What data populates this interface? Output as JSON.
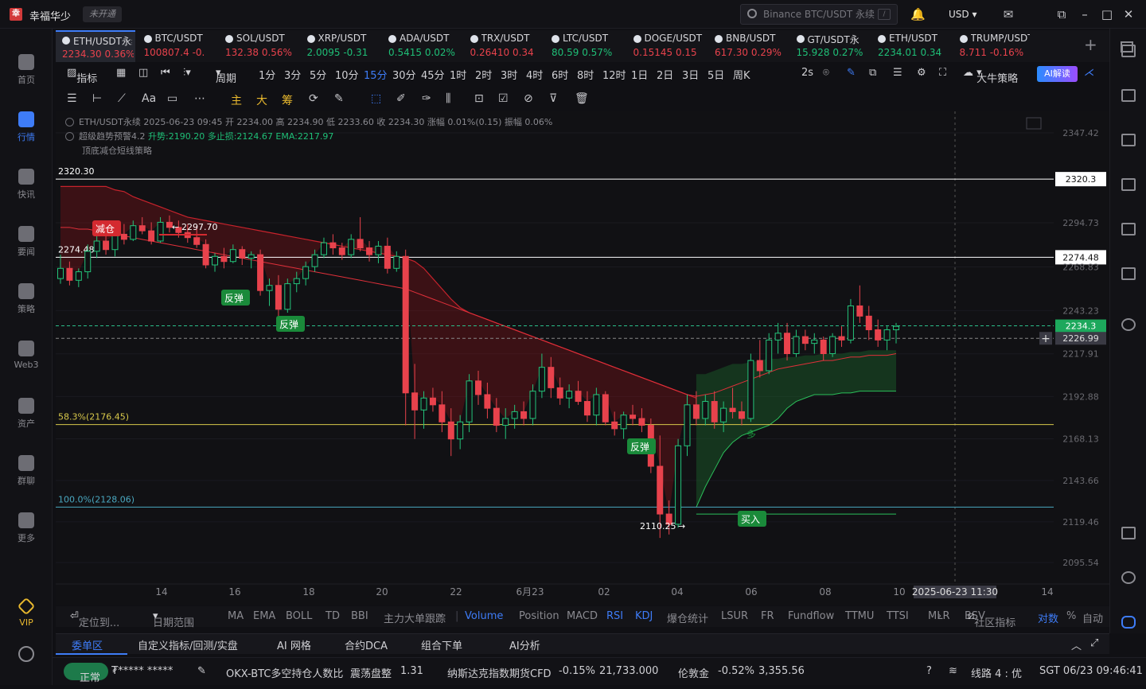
{
  "titlebar": {
    "app_name": "幸福华少",
    "unverified": "未开通",
    "search_placeholder": "Binance BTC/USDT 永续",
    "search_shortcut": "/",
    "currency": "USD"
  },
  "sidebar": {
    "items": [
      {
        "label": "首页",
        "icon": "home-icon"
      },
      {
        "label": "行情",
        "icon": "chart-icon",
        "active": true
      },
      {
        "label": "快讯",
        "icon": "news-icon"
      },
      {
        "label": "要闻",
        "icon": "headline-icon"
      },
      {
        "label": "策略",
        "icon": "strategy-icon"
      },
      {
        "label": "Web3",
        "icon": "web3-icon"
      },
      {
        "label": "资产",
        "icon": "wallet-icon"
      },
      {
        "label": "群聊",
        "icon": "chat-icon"
      },
      {
        "label": "更多",
        "icon": "more-icon"
      }
    ],
    "vip_label": "VIP"
  },
  "tickers": [
    {
      "name": "ETH/USDT永续",
      "price": "2234.30",
      "change": "0.36%",
      "dir": "dn",
      "active": true
    },
    {
      "name": "BTC/USDT",
      "price": "100807.4",
      "change": "-0.",
      "dir": "dn"
    },
    {
      "name": "SOL/USDT",
      "price": "132.38",
      "change": "0.56%",
      "dir": "dn"
    },
    {
      "name": "XRP/USDT",
      "price": "2.0095",
      "change": "-0.31",
      "dir": "up"
    },
    {
      "name": "ADA/USDT",
      "price": "0.5415",
      "change": "0.02%",
      "dir": "up"
    },
    {
      "name": "TRX/USDT",
      "price": "0.26410",
      "change": "0.34",
      "dir": "dn"
    },
    {
      "name": "LTC/USDT",
      "price": "80.59",
      "change": "0.57%",
      "dir": "up"
    },
    {
      "name": "DOGE/USDT",
      "price": "0.15145",
      "change": "0.15",
      "dir": "dn"
    },
    {
      "name": "BNB/USDT",
      "price": "617.30",
      "change": "0.29%",
      "dir": "dn"
    },
    {
      "name": "GT/USDT永",
      "price": "15.928",
      "change": "0.27%",
      "dir": "up"
    },
    {
      "name": "ETH/USDT",
      "price": "2234.01",
      "change": "0.34",
      "dir": "up"
    },
    {
      "name": "TRUMP/USDT",
      "price": "8.711",
      "change": "-0.16%",
      "dir": "dn"
    }
  ],
  "toolbar1": {
    "indicator": "指标",
    "period": "周期",
    "intervals": [
      "1分",
      "3分",
      "5分",
      "10分",
      "15分",
      "30分",
      "45分",
      "1时",
      "2时",
      "3时",
      "4时",
      "6时",
      "8时",
      "12时",
      "1日",
      "2日",
      "3日",
      "5日",
      "周K"
    ],
    "selected": "15分",
    "refresh": "2s",
    "strategy": "大牛策略",
    "ai_button": "AI解读"
  },
  "toolbar2": {
    "tools": [
      "主",
      "大",
      "筹"
    ]
  },
  "chart_info": {
    "line1": "ETH/USDT永续 2025-06-23 09:45 开 2234.00 高 2234.90 低 2233.60 收 2234.30 涨幅 0.01%(0.15) 振幅 0.06%",
    "line2_name": "超级趋势预警4.2",
    "line2_trend": "升势:2190.20",
    "line2_stop": "多止损:2124.67",
    "line2_ema": "EMA:2217.97",
    "line3": "顶底减仓短线策略"
  },
  "chart_data": {
    "type": "candlestick",
    "symbol": "ETH/USDT永续",
    "y_ticks": [
      2347.42,
      2320.3,
      2294.73,
      2274.48,
      2268.83,
      2243.23,
      2234.3,
      2226.99,
      2217.91,
      2192.88,
      2168.13,
      2143.66,
      2119.46,
      2095.54
    ],
    "ylim": [
      2083,
      2360
    ],
    "x_ticks": [
      "14",
      "16",
      "18",
      "20",
      "22",
      "6月23",
      "02",
      "04",
      "06",
      "08",
      "10",
      "2025-06-23 11:30",
      "14"
    ],
    "hlines": [
      {
        "value": 2320.3,
        "label": "2320.30"
      },
      {
        "value": 2274.48,
        "label": "2274.48"
      },
      {
        "value": 2176.45,
        "label": "58.3%(2176.45)"
      },
      {
        "value": 2128.06,
        "label": "100.0%(2128.06)"
      }
    ],
    "price_tags": [
      {
        "value": "2234.30"
      },
      {
        "value": "2226.99"
      }
    ],
    "annotations": [
      {
        "text": "减仓"
      },
      {
        "text": "2297.70"
      },
      {
        "text": "反弹"
      },
      {
        "text": "反弹"
      },
      {
        "text": "反弹"
      },
      {
        "text": "买入"
      },
      {
        "text": "多"
      },
      {
        "text": "2110.25"
      }
    ],
    "candles": [
      [
        2262,
        2276,
        2259,
        2268
      ],
      [
        2268,
        2272,
        2258,
        2261
      ],
      [
        2261,
        2268,
        2257,
        2266
      ],
      [
        2266,
        2282,
        2262,
        2278
      ],
      [
        2278,
        2290,
        2274,
        2284
      ],
      [
        2284,
        2288,
        2276,
        2279
      ],
      [
        2279,
        2290,
        2275,
        2288
      ],
      [
        2288,
        2294,
        2282,
        2285
      ],
      [
        2285,
        2296,
        2284,
        2293
      ],
      [
        2293,
        2298,
        2288,
        2290
      ],
      [
        2290,
        2295,
        2282,
        2284
      ],
      [
        2284,
        2298,
        2283,
        2295
      ],
      [
        2295,
        2299,
        2289,
        2292
      ],
      [
        2292,
        2296,
        2286,
        2289
      ],
      [
        2289,
        2294,
        2283,
        2286
      ],
      [
        2286,
        2292,
        2280,
        2282
      ],
      [
        2282,
        2285,
        2268,
        2270
      ],
      [
        2270,
        2277,
        2266,
        2275
      ],
      [
        2275,
        2280,
        2268,
        2272
      ],
      [
        2272,
        2282,
        2271,
        2279
      ],
      [
        2279,
        2281,
        2270,
        2274
      ],
      [
        2274,
        2278,
        2268,
        2276
      ],
      [
        2276,
        2279,
        2252,
        2255
      ],
      [
        2255,
        2262,
        2246,
        2258
      ],
      [
        2258,
        2264,
        2240,
        2244
      ],
      [
        2244,
        2262,
        2242,
        2259
      ],
      [
        2259,
        2266,
        2254,
        2262
      ],
      [
        2262,
        2272,
        2258,
        2269
      ],
      [
        2269,
        2279,
        2266,
        2276
      ],
      [
        2276,
        2286,
        2274,
        2283
      ],
      [
        2283,
        2288,
        2276,
        2280
      ],
      [
        2280,
        2283,
        2273,
        2276
      ],
      [
        2276,
        2288,
        2274,
        2285
      ],
      [
        2285,
        2298,
        2278,
        2280
      ],
      [
        2280,
        2284,
        2272,
        2276
      ],
      [
        2276,
        2284,
        2271,
        2281
      ],
      [
        2281,
        2286,
        2265,
        2268
      ],
      [
        2268,
        2278,
        2266,
        2275
      ],
      [
        2275,
        2279,
        2176,
        2195
      ],
      [
        2195,
        2212,
        2168,
        2185
      ],
      [
        2185,
        2196,
        2174,
        2192
      ],
      [
        2192,
        2198,
        2184,
        2188
      ],
      [
        2188,
        2196,
        2172,
        2178
      ],
      [
        2178,
        2186,
        2158,
        2168
      ],
      [
        2168,
        2182,
        2162,
        2178
      ],
      [
        2178,
        2206,
        2172,
        2202
      ],
      [
        2202,
        2208,
        2188,
        2194
      ],
      [
        2194,
        2201,
        2180,
        2186
      ],
      [
        2186,
        2192,
        2172,
        2176
      ],
      [
        2176,
        2186,
        2168,
        2180
      ],
      [
        2180,
        2188,
        2174,
        2184
      ],
      [
        2184,
        2190,
        2176,
        2180
      ],
      [
        2180,
        2200,
        2176,
        2196
      ],
      [
        2196,
        2218,
        2192,
        2210
      ],
      [
        2210,
        2216,
        2192,
        2198
      ],
      [
        2198,
        2204,
        2188,
        2192
      ],
      [
        2192,
        2200,
        2186,
        2196
      ],
      [
        2196,
        2202,
        2188,
        2190
      ],
      [
        2190,
        2196,
        2178,
        2182
      ],
      [
        2182,
        2198,
        2176,
        2194
      ],
      [
        2194,
        2196,
        2176,
        2178
      ],
      [
        2178,
        2184,
        2170,
        2174
      ],
      [
        2174,
        2184,
        2168,
        2182
      ],
      [
        2182,
        2188,
        2176,
        2180
      ],
      [
        2180,
        2186,
        2172,
        2176
      ],
      [
        2176,
        2180,
        2148,
        2152
      ],
      [
        2152,
        2170,
        2110,
        2124
      ],
      [
        2124,
        2132,
        2112,
        2118
      ],
      [
        2118,
        2168,
        2116,
        2164
      ],
      [
        2164,
        2194,
        2158,
        2188
      ],
      [
        2188,
        2196,
        2176,
        2180
      ],
      [
        2180,
        2194,
        2176,
        2190
      ],
      [
        2190,
        2196,
        2174,
        2178
      ],
      [
        2178,
        2190,
        2172,
        2186
      ],
      [
        2186,
        2198,
        2180,
        2184
      ],
      [
        2184,
        2190,
        2176,
        2180
      ],
      [
        2180,
        2218,
        2178,
        2214
      ],
      [
        2214,
        2226,
        2204,
        2208
      ],
      [
        2208,
        2230,
        2206,
        2226
      ],
      [
        2226,
        2236,
        2218,
        2230
      ],
      [
        2230,
        2236,
        2214,
        2218
      ],
      [
        2218,
        2232,
        2216,
        2228
      ],
      [
        2228,
        2232,
        2220,
        2224
      ],
      [
        2224,
        2230,
        2218,
        2226
      ],
      [
        2226,
        2228,
        2214,
        2218
      ],
      [
        2218,
        2230,
        2216,
        2228
      ],
      [
        2228,
        2234,
        2222,
        2226
      ],
      [
        2226,
        2250,
        2224,
        2246
      ],
      [
        2246,
        2258,
        2236,
        2240
      ],
      [
        2240,
        2246,
        2226,
        2232
      ],
      [
        2232,
        2238,
        2222,
        2226
      ],
      [
        2226,
        2234,
        2220,
        2232
      ],
      [
        2232,
        2236,
        2224,
        2234
      ]
    ],
    "supertrend_upper": [
      2316,
      2316,
      2316,
      2316,
      2316,
      2316,
      2314,
      2313,
      2310,
      2308,
      2306,
      2304,
      2302,
      2300,
      2298,
      2297,
      2296,
      2295,
      2294,
      2293,
      2292,
      2291,
      2290,
      2289,
      2288,
      2287,
      2286,
      2285,
      2284,
      2283,
      2282,
      2281,
      2280,
      2279,
      2278,
      2277,
      2276,
      2275,
      2274,
      2272,
      2268,
      2262,
      2256,
      2250,
      2245,
      2242,
      2240,
      2238,
      2236,
      2234,
      2232,
      2230,
      2228,
      2226,
      2224,
      2222,
      2220,
      2218,
      2216,
      2214,
      2212,
      2210,
      2208,
      2206,
      2204,
      2202,
      2200,
      2198,
      2196,
      2194,
      2192
    ],
    "ema": [
      2292,
      2292,
      2291,
      2291,
      2290,
      2289,
      2288,
      2287,
      2286,
      2285,
      2284,
      2283,
      2282,
      2281,
      2280,
      2279,
      2278,
      2277,
      2276,
      2275,
      2274,
      2273,
      2272,
      2271,
      2270,
      2269,
      2268,
      2267,
      2266,
      2265,
      2264,
      2263,
      2262,
      2261,
      2260,
      2259,
      2258,
      2257,
      2256,
      2254,
      2252,
      2250,
      2248,
      2246,
      2244,
      2242,
      2240,
      2238,
      2236,
      2234,
      2232,
      2230,
      2228,
      2226,
      2224,
      2222,
      2220,
      2218,
      2216,
      2214,
      2212,
      2210,
      2208,
      2206,
      2204,
      2202,
      2200,
      2198,
      2196,
      2194,
      2193,
      2194,
      2195,
      2197,
      2199,
      2201,
      2203,
      2205,
      2207,
      2209,
      2210,
      2211,
      2212,
      2213,
      2214,
      2214,
      2215,
      2216,
      2216,
      2217,
      2217,
      2217,
      2218
    ]
  },
  "indicator_bar": {
    "locate": "定位到...",
    "range": "日期范围",
    "items": [
      "MA",
      "EMA",
      "BOLL",
      "TD",
      "BBI",
      "主力大单跟踪"
    ],
    "subs": [
      "Volume",
      "Position",
      "MACD",
      "RSI",
      "KDJ",
      "爆仓统计",
      "LSUR",
      "FR",
      "Fundflow",
      "TTMU",
      "TTSI",
      "MLR",
      "BSV"
    ],
    "community": "社区指标",
    "compare": "对数",
    "percent": "%",
    "auto": "自动"
  },
  "bottom_tabs": [
    "委单区",
    "自定义指标/回测/实盘",
    "AI 网格",
    "合约DCA",
    "组合下单",
    "AI分析"
  ],
  "status": {
    "state": "正常",
    "account": "₮*****  *****",
    "news1": "OKX-BTC多空持仓人数比",
    "news1_tag": "震荡盘整",
    "news1_val": "1.31",
    "news2": "纳斯达克指数期货CFD",
    "news2_chg": "-0.15%",
    "news2_val": "21,733.000",
    "news3": "伦敦金",
    "news3_chg": "-0.52%",
    "news3_val": "3,355.56",
    "line": "线路 4 : 优",
    "clock": "SGT 06/23 09:46:41"
  }
}
